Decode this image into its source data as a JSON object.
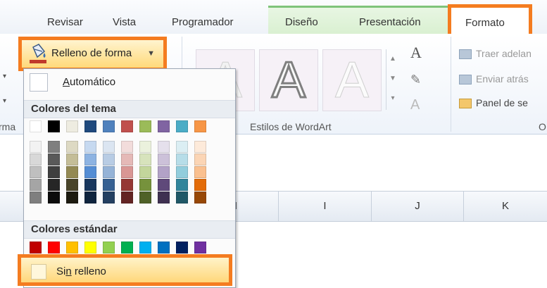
{
  "tabs": [
    "Revisar",
    "Vista",
    "Programador",
    "Diseño",
    "Presentación"
  ],
  "active_tab": "Formato",
  "fill_button": {
    "label": "Relleno de forma"
  },
  "menu": {
    "automatic_label": "Automático",
    "theme_header": "Colores del tema",
    "standard_header": "Colores estándar",
    "no_fill_prefix": "Si",
    "no_fill_underlined": "n",
    "no_fill_suffix": " relleno"
  },
  "theme_colors_top": [
    "#ffffff",
    "#000000",
    "#eeece1",
    "#1f497d",
    "#4f81bd",
    "#c0504d",
    "#9bbb59",
    "#8064a2",
    "#4bacc6",
    "#f79646"
  ],
  "theme_shades": [
    [
      "#f2f2f2",
      "#7f7f7f",
      "#ddd9c3",
      "#c6d9f0",
      "#dbe5f1",
      "#f2dcdb",
      "#ebf1dd",
      "#e5e0ec",
      "#dbeef3",
      "#fdeada"
    ],
    [
      "#d8d8d8",
      "#595959",
      "#c4bd97",
      "#8db3e2",
      "#b8cce4",
      "#e5b9b7",
      "#d7e3bc",
      "#ccc1d9",
      "#b7dde8",
      "#fbd5b5"
    ],
    [
      "#bfbfbf",
      "#3f3f3f",
      "#938953",
      "#548dd4",
      "#95b3d7",
      "#d99694",
      "#c3d69b",
      "#b2a2c7",
      "#92cddc",
      "#fac08f"
    ],
    [
      "#a5a5a5",
      "#262626",
      "#494429",
      "#17365d",
      "#366092",
      "#953734",
      "#76923c",
      "#5f497a",
      "#31859b",
      "#e36c09"
    ],
    [
      "#7f7f7f",
      "#0c0c0c",
      "#1d1b10",
      "#0f243e",
      "#244061",
      "#632423",
      "#4f6128",
      "#3f3151",
      "#205867",
      "#974806"
    ]
  ],
  "standard_colors": [
    "#c00000",
    "#ff0000",
    "#ffc000",
    "#ffff00",
    "#92d050",
    "#00b050",
    "#00b0f0",
    "#0070c0",
    "#002060",
    "#7030a0"
  ],
  "wordart_group_label": "Estilos de WordArt",
  "wordart_letter": "A",
  "arrange_commands": [
    "Traer adelan",
    "Enviar atrás",
    "Panel de se"
  ],
  "group_label_partial_left": "rma",
  "group_label_partial_right": "O",
  "column_headers": [
    "H",
    "I",
    "J",
    "K"
  ]
}
